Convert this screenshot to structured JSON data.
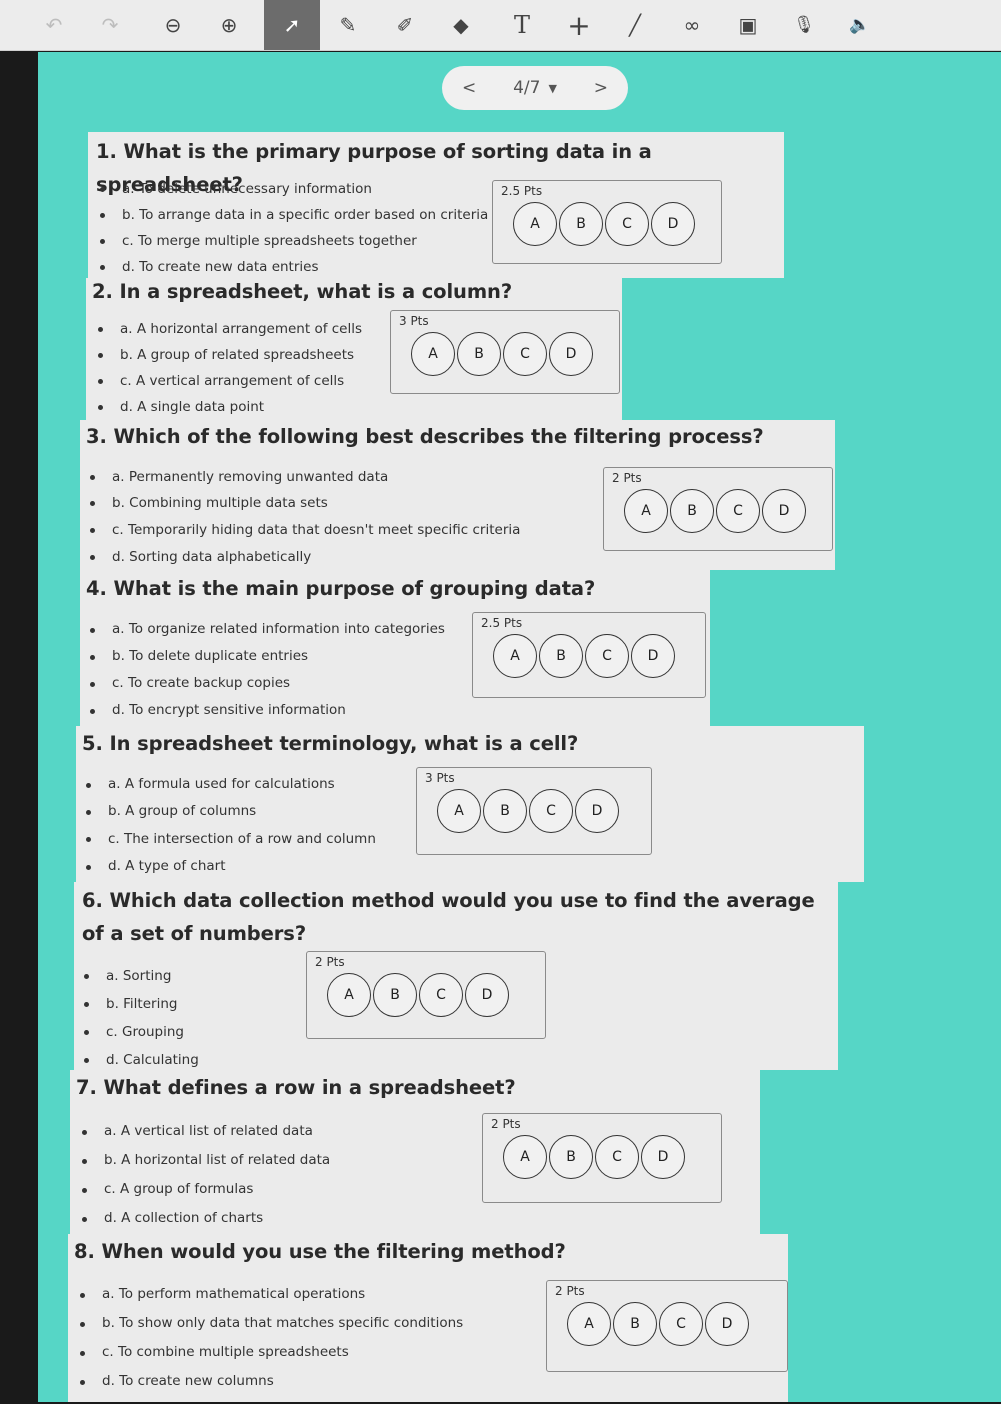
{
  "toolbar": {
    "tools": [
      {
        "name": "undo-icon",
        "glyph": "↶"
      },
      {
        "name": "redo-icon",
        "glyph": "↷"
      },
      {
        "name": "zoom-out-icon",
        "glyph": "⊖"
      },
      {
        "name": "zoom-in-icon",
        "glyph": "⊕"
      },
      {
        "name": "select-pointer-icon",
        "glyph": "➚"
      },
      {
        "name": "pen-icon",
        "glyph": "✎"
      },
      {
        "name": "highlighter-icon",
        "glyph": "✐"
      },
      {
        "name": "eraser-icon",
        "glyph": "◆"
      },
      {
        "name": "text-icon",
        "glyph": "T"
      },
      {
        "name": "add-icon",
        "glyph": "+"
      },
      {
        "name": "line-icon",
        "glyph": "╱"
      },
      {
        "name": "link-icon",
        "glyph": "∞"
      },
      {
        "name": "insert-image-icon",
        "glyph": "▣"
      },
      {
        "name": "microphone-icon",
        "glyph": "🎙"
      },
      {
        "name": "speaker-icon",
        "glyph": "🔈"
      }
    ]
  },
  "pager": {
    "prev": "<",
    "page": "4/7",
    "caret": "▼",
    "next": ">"
  },
  "questions": [
    {
      "title": "1. What is the primary purpose of sorting data in a spreadsheet?",
      "options": [
        "a. To delete unnecessary information",
        "b. To arrange data in a specific order based on criteria",
        "c. To merge multiple spreadsheets together",
        "d. To create new data entries"
      ],
      "points": "2.5 Pts",
      "choices": [
        "A",
        "B",
        "C",
        "D"
      ]
    },
    {
      "title": "2. In a spreadsheet, what is a column?",
      "options": [
        "a. A horizontal arrangement of cells",
        "b. A group of related spreadsheets",
        "c. A vertical arrangement of cells",
        "d. A single data point"
      ],
      "points": "3 Pts",
      "choices": [
        "A",
        "B",
        "C",
        "D"
      ]
    },
    {
      "title": "3. Which of the following best describes the filtering process?",
      "options": [
        "a. Permanently removing unwanted data",
        "b. Combining multiple data sets",
        "c. Temporarily hiding data that doesn't meet specific criteria",
        "d. Sorting data alphabetically"
      ],
      "points": "2 Pts",
      "choices": [
        "A",
        "B",
        "C",
        "D"
      ]
    },
    {
      "title": "4. What is the main purpose of grouping data?",
      "options": [
        "a. To organize related information into categories",
        "b. To delete duplicate entries",
        "c. To create backup copies",
        "d. To encrypt sensitive information"
      ],
      "points": "2.5 Pts",
      "choices": [
        "A",
        "B",
        "C",
        "D"
      ]
    },
    {
      "title": "5. In spreadsheet terminology, what is a cell?",
      "options": [
        "a. A formula used for calculations",
        "b. A group of columns",
        "c. The intersection of a row and column",
        "d. A type of chart"
      ],
      "points": "3 Pts",
      "choices": [
        "A",
        "B",
        "C",
        "D"
      ]
    },
    {
      "title": "6. Which data collection method would you use to find the average of a set of numbers?",
      "options": [
        "a. Sorting",
        "b. Filtering",
        "c. Grouping",
        "d. Calculating"
      ],
      "points": "2 Pts",
      "choices": [
        "A",
        "B",
        "C",
        "D"
      ]
    },
    {
      "title": "7. What defines a row in a spreadsheet?",
      "options": [
        "a. A vertical list of related data",
        "b. A horizontal list of related data",
        "c. A group of formulas",
        "d. A collection of charts"
      ],
      "points": "2 Pts",
      "choices": [
        "A",
        "B",
        "C",
        "D"
      ]
    },
    {
      "title": "8. When would you use the filtering method?",
      "options": [
        "a. To perform mathematical operations",
        "b. To show only data that matches specific conditions",
        "c. To combine multiple spreadsheets",
        "d. To create new columns"
      ],
      "points": "2 Pts",
      "choices": [
        "A",
        "B",
        "C",
        "D"
      ]
    }
  ]
}
